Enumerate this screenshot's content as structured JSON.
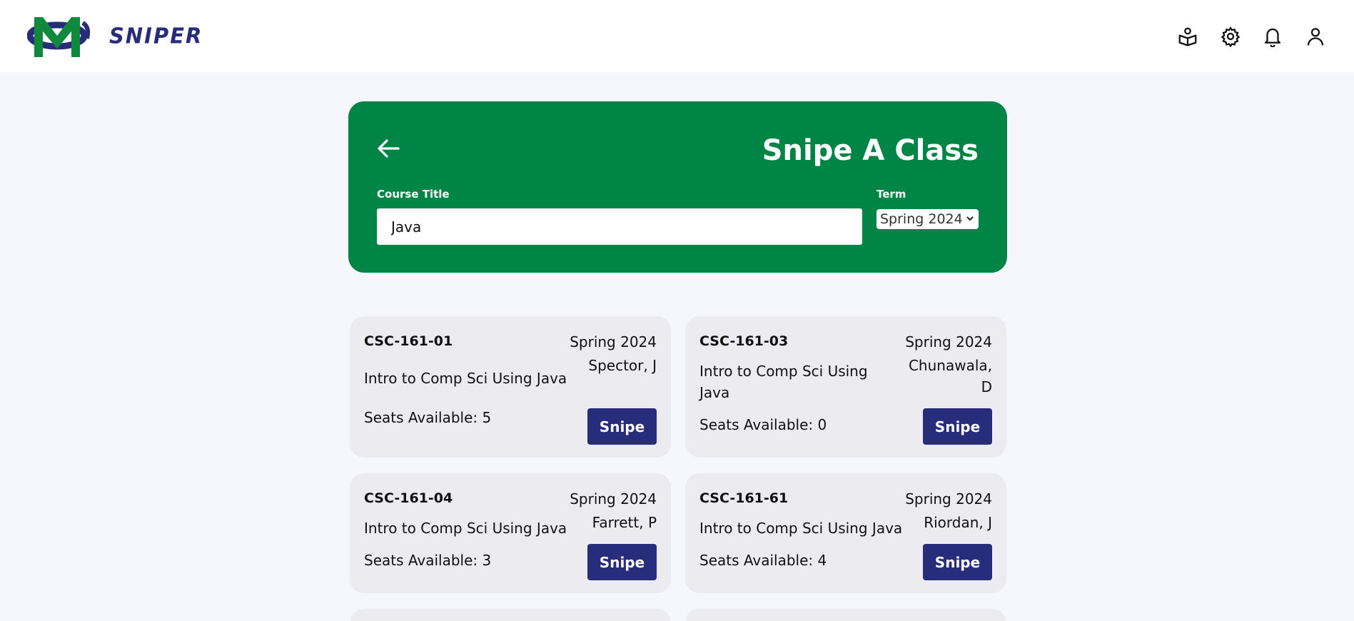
{
  "header": {
    "brand": "SNIPER",
    "icons": [
      "book-reader-icon",
      "gear-icon",
      "bell-icon",
      "user-icon"
    ]
  },
  "colors": {
    "brand_navy": "#272d7b",
    "brand_green": "#008546",
    "background": "#f6f7fc",
    "card": "#ebebf0"
  },
  "search": {
    "title": "Snipe A Class",
    "course_label": "Course Title",
    "course_value": "Java",
    "term_label": "Term",
    "term_selected": "Spring 2024"
  },
  "results": [
    {
      "code": "CSC-161-01",
      "term": "Spring 2024",
      "instructor": "Spector, J",
      "title": "Intro to Comp Sci Using Java",
      "seats": "Seats Available: 5",
      "button": "Snipe"
    },
    {
      "code": "CSC-161-03",
      "term": "Spring 2024",
      "instructor": "Chunawala, D",
      "title": "Intro to Comp Sci Using Java",
      "seats": "Seats Available: 0",
      "button": "Snipe"
    },
    {
      "code": "CSC-161-04",
      "term": "Spring 2024",
      "instructor": "Farrett, P",
      "title": "Intro to Comp Sci Using Java",
      "seats": "Seats Available: 3",
      "button": "Snipe"
    },
    {
      "code": "CSC-161-61",
      "term": "Spring 2024",
      "instructor": "Riordan, J",
      "title": "Intro to Comp Sci Using Java",
      "seats": "Seats Available: 4",
      "button": "Snipe"
    }
  ]
}
